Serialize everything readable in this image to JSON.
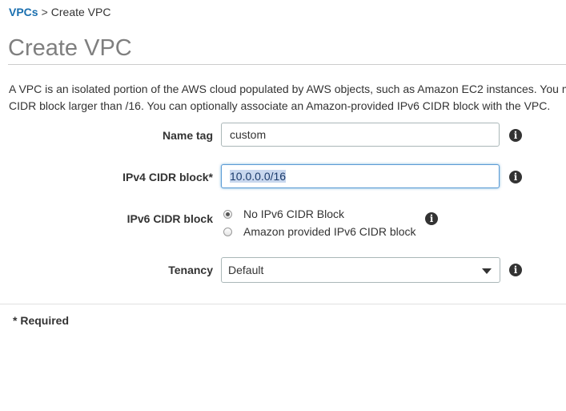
{
  "breadcrumb": {
    "parent": "VPCs",
    "separator": ">",
    "current": "Create VPC"
  },
  "page": {
    "title": "Create VPC",
    "description_line1": "A VPC is an isolated portion of the AWS cloud populated by AWS objects, such as Amazon EC2 instances. You m",
    "description_line2": "CIDR block larger than /16. You can optionally associate an Amazon-provided IPv6 CIDR block with the VPC."
  },
  "form": {
    "name_tag": {
      "label": "Name tag",
      "value": "custom"
    },
    "ipv4_cidr": {
      "label": "IPv4 CIDR block*",
      "value": "10.0.0.0/16",
      "selected": true
    },
    "ipv6_cidr": {
      "label": "IPv6 CIDR block",
      "options": [
        {
          "label": "No IPv6 CIDR Block",
          "checked": true
        },
        {
          "label": "Amazon provided IPv6 CIDR block",
          "checked": false
        }
      ]
    },
    "tenancy": {
      "label": "Tenancy",
      "value": "Default"
    },
    "info_icon": {
      "glyph": "i",
      "icon": "info-icon"
    }
  },
  "footer": {
    "required_note": "* Required"
  },
  "colors": {
    "link": "#1a6faf",
    "title": "#7f7f7f",
    "focus": "#5b9bd5",
    "selection": "#c8d7ee"
  }
}
